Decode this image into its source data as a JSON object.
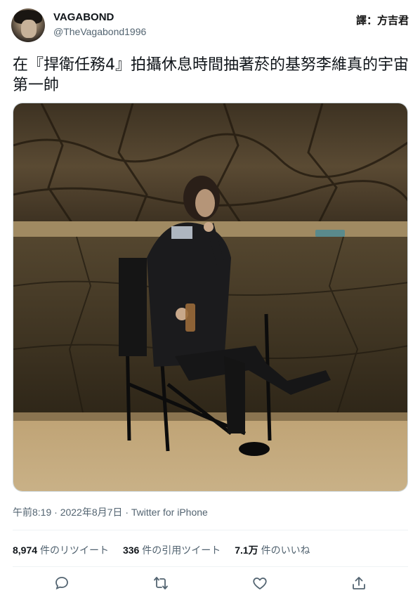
{
  "author": {
    "name": "VAGABOND",
    "handle": "@TheVagabond1996"
  },
  "watermark": "譯：方吉君",
  "tweet": {
    "text": "在『捍衛任務4』拍攝休息時間抽著菸的基努李維真的宇宙第一帥"
  },
  "meta": {
    "time": "午前8:19",
    "separator": "·",
    "date": "2022年8月7日",
    "source": "Twitter for iPhone"
  },
  "stats": {
    "retweets_count": "8,974",
    "retweets_label": "件のリツイート",
    "quotes_count": "336",
    "quotes_label": "件の引用ツイート",
    "likes_count": "7.1万",
    "likes_label": "件のいいね"
  },
  "icons": {
    "reply": "reply-icon",
    "retweet": "retweet-icon",
    "like": "like-icon",
    "share": "share-icon"
  },
  "colors": {
    "text": "#0f1419",
    "secondary": "#536471",
    "divider": "#eff3f4"
  }
}
